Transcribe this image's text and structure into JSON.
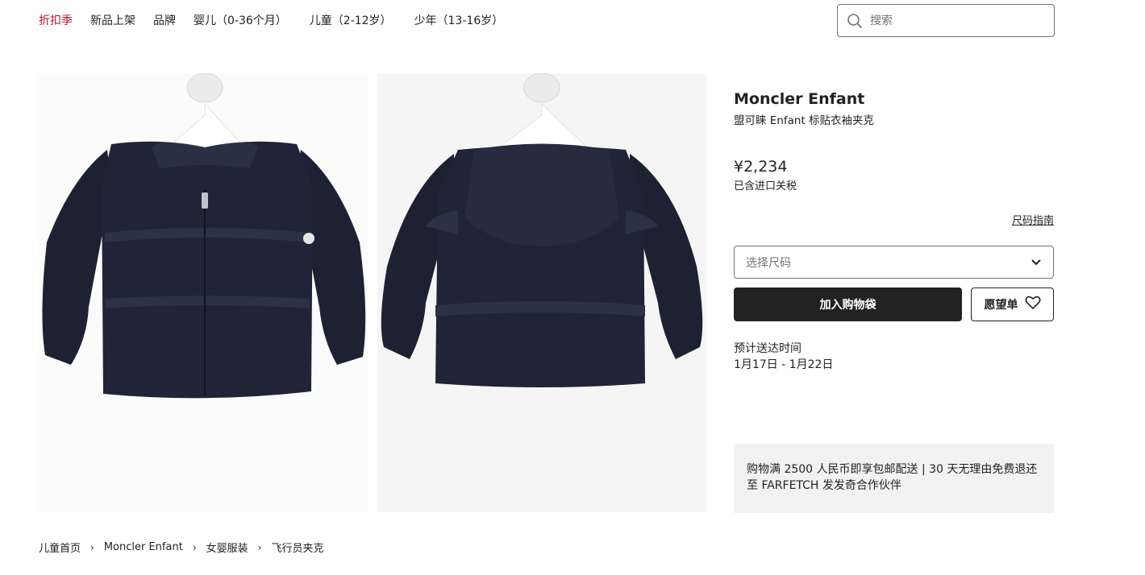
{
  "nav": {
    "items": [
      "折扣季",
      "新品上架",
      "品牌",
      "婴儿（0-36个月）",
      "儿童（2-12岁）",
      "少年（13-16岁）"
    ]
  },
  "search": {
    "placeholder": "搜索"
  },
  "product": {
    "brand": "Moncler Enfant",
    "name": "盟可睐 Enfant 标贴衣袖夹克",
    "price": "¥2,234",
    "tax_note": "已含进口关税",
    "size_guide": "尺码指南",
    "size_placeholder": "选择尺码",
    "add_to_bag": "加入购物袋",
    "wishlist": "愿望单",
    "delivery_label": "预计送达时间",
    "delivery_date": "1月17日 - 1月22日",
    "promo": "购物满 2500 人民币即享包邮配送 | 30 天无理由免费退还至 FARFETCH 发发奇合作伙伴"
  },
  "breadcrumb": [
    "儿童首页",
    "Moncler Enfant",
    "女婴服装",
    "飞行员夹克"
  ],
  "colors": {
    "sale": "#b8122d",
    "primary_button": "#222222",
    "jacket": "#1d2233"
  }
}
